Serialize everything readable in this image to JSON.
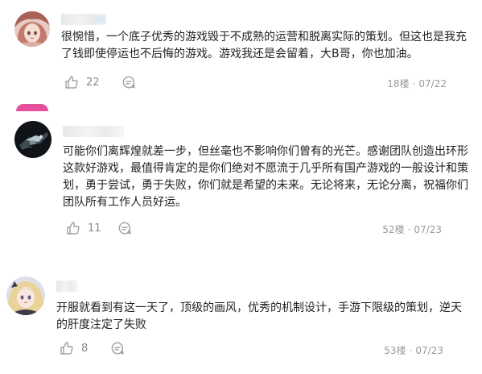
{
  "comments": [
    {
      "content": "很惋惜，一个底子优秀的游戏毁于不成熟的运营和脱离实际的策划。但这也是我充了钱即使停运也不后悔的游戏。游戏我还是会留着，大B哥，你也加油。",
      "likes": "22",
      "floor": "18楼",
      "date": "07/22",
      "avatar_icon": "anime-girl-avatar"
    },
    {
      "content": "可能你们离辉煌就差一步，但丝毫也不影响你们曾有的光芒。感谢团队创造出环形这款好游戏，最值得肯定的是你们绝对不愿流于几乎所有国产游戏的一般设计和策划，勇于尝试，勇于失败，你们就是希望的未来。无论将来，无论分离，祝福你们团队所有工作人员好运。",
      "likes": "11",
      "floor": "52楼",
      "date": "07/23",
      "avatar_icon": "dark-mech-avatar"
    },
    {
      "content": "开服就看到有这一天了，顶级的画风，优秀的机制设计，手游下限级的策划，逆天的肝度注定了失败",
      "likes": "8",
      "floor": "53楼",
      "date": "07/23",
      "avatar_icon": "blonde-girl-avatar"
    }
  ],
  "icons": {
    "like": "thumbs-up-icon",
    "reply": "reply-bubble-icon"
  },
  "colors": {
    "text": "#222222",
    "muted": "#999999",
    "icon": "#a0a0a0",
    "accent_sliver": "#e64f9b"
  }
}
